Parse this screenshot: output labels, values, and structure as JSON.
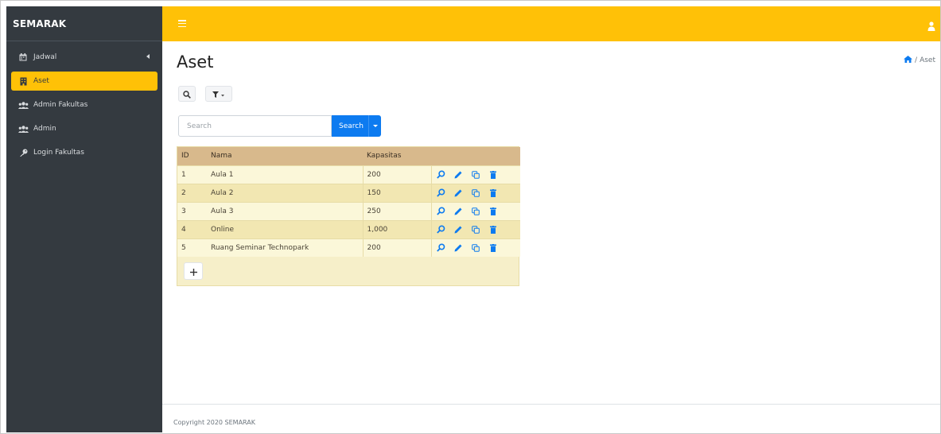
{
  "app": {
    "brand": "SEMARAK"
  },
  "sidebar": {
    "items": [
      {
        "label": "Jadwal",
        "icon": "calendar-icon",
        "active": false,
        "has_caret": true
      },
      {
        "label": "Aset",
        "icon": "building-icon",
        "active": true
      },
      {
        "label": "Admin Fakultas",
        "icon": "users-icon",
        "active": false
      },
      {
        "label": "Admin",
        "icon": "users-icon",
        "active": false
      },
      {
        "label": "Login Fakultas",
        "icon": "key-icon",
        "active": false
      }
    ]
  },
  "header": {
    "menu_icon": "hamburger-icon",
    "user_icon": "user-icon"
  },
  "page": {
    "title": "Aset",
    "breadcrumb": {
      "home_icon": "home-icon",
      "separator": "/",
      "current": "Aset"
    }
  },
  "toolbar": {
    "search_icon": "search-icon",
    "filter_icon": "filter-icon"
  },
  "search": {
    "placeholder": "Search",
    "button_label": "Search"
  },
  "table": {
    "columns": [
      "ID",
      "Nama",
      "Kapasitas"
    ],
    "rows": [
      {
        "id": "1",
        "nama": "Aula 1",
        "kapasitas": "200"
      },
      {
        "id": "2",
        "nama": "Aula 2",
        "kapasitas": "150"
      },
      {
        "id": "3",
        "nama": "Aula 3",
        "kapasitas": "250"
      },
      {
        "id": "4",
        "nama": "Online",
        "kapasitas": "1,000"
      },
      {
        "id": "5",
        "nama": "Ruang Seminar Technopark",
        "kapasitas": "200"
      }
    ],
    "row_actions": [
      "view-icon",
      "edit-icon",
      "copy-icon",
      "delete-icon"
    ],
    "add_icon": "plus-icon"
  },
  "footer": {
    "text": "Copyright 2020 SEMARAK"
  },
  "colors": {
    "accent": "#ffc107",
    "sidebar": "#343a40",
    "primary": "#0d7bf0",
    "table_header": "#d8b98c"
  }
}
